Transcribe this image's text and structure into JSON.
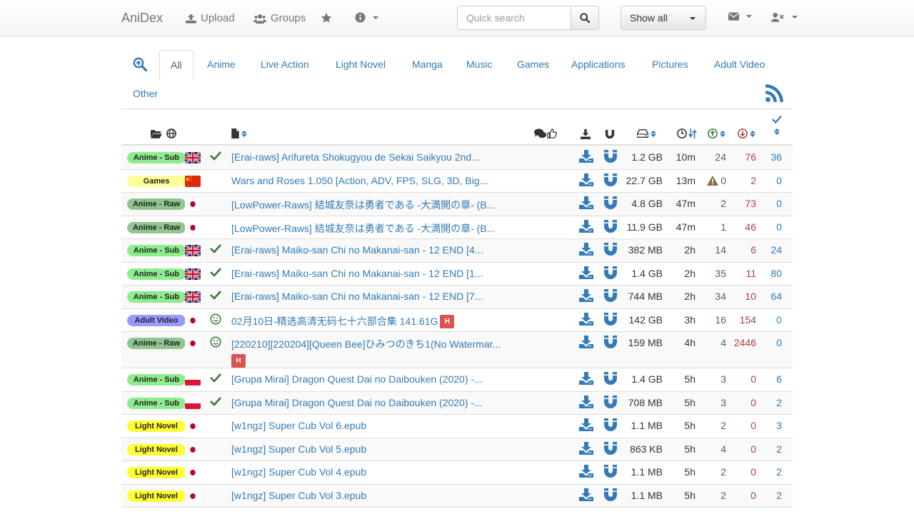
{
  "nav": {
    "brand": "AniDex",
    "upload": "Upload",
    "groups": "Groups",
    "search_placeholder": "Quick search",
    "filter_value": "Show all"
  },
  "tabs": [
    "All",
    "Anime",
    "Live Action",
    "Light Novel",
    "Manga",
    "Music",
    "Games",
    "Applications",
    "Pictures",
    "Adult Video",
    "Other"
  ],
  "active_tab": "All",
  "colors": {
    "anime_sub": "#8ded8d",
    "games": "#ffff99",
    "anime_raw": "#8fc58f",
    "adult_video": "#9999ff",
    "light_novel": "#ffff33",
    "link": "#337ab7",
    "seed_green": "#3c763d",
    "leech_red": "#a94442"
  },
  "rows": [
    {
      "category": "Anime - Sub",
      "cat_color": "#8ded8d",
      "flag": "gb",
      "status": "check",
      "title": "[Erai-raws] Arifureta Shokugyou de Sekai Saikyou 2nd...",
      "h": false,
      "size": "1.2 GB",
      "age": "10m",
      "seeders": "24",
      "leechers": "76",
      "completed": "36",
      "warn": false
    },
    {
      "category": "Games",
      "cat_color": "#ffff99",
      "flag": "cn",
      "status": "",
      "title": "Wars and Roses 1.050 [Action, ADV, FPS, SLG, 3D, Big...",
      "h": false,
      "size": "22.7 GB",
      "age": "13m",
      "seeders": "0",
      "leechers": "2",
      "completed": "0",
      "warn": true
    },
    {
      "category": "Anime - Raw",
      "cat_color": "#8fc58f",
      "flag": "jp",
      "status": "",
      "title": "[LowPower-Raws] 結城友奈は勇者である -大満開の章- (B...",
      "h": false,
      "size": "4.8 GB",
      "age": "47m",
      "seeders": "2",
      "leechers": "73",
      "completed": "0",
      "warn": false
    },
    {
      "category": "Anime - Raw",
      "cat_color": "#8fc58f",
      "flag": "jp",
      "status": "",
      "title": "[LowPower-Raws] 結城友奈は勇者である -大満開の章- (B...",
      "h": false,
      "size": "11.9 GB",
      "age": "47m",
      "seeders": "1",
      "leechers": "46",
      "completed": "0",
      "warn": false
    },
    {
      "category": "Anime - Sub",
      "cat_color": "#8ded8d",
      "flag": "gb",
      "status": "check",
      "title": "[Erai-raws] Maiko-san Chi no Makanai-san - 12 END [4...",
      "h": false,
      "size": "382 MB",
      "age": "2h",
      "seeders": "14",
      "leechers": "6",
      "completed": "24",
      "warn": false
    },
    {
      "category": "Anime - Sub",
      "cat_color": "#8ded8d",
      "flag": "gb",
      "status": "check",
      "title": "[Erai-raws] Maiko-san Chi no Makanai-san - 12 END [1...",
      "h": false,
      "size": "1.4 GB",
      "age": "2h",
      "seeders": "35",
      "leechers": "11",
      "completed": "80",
      "warn": false
    },
    {
      "category": "Anime - Sub",
      "cat_color": "#8ded8d",
      "flag": "gb",
      "status": "check",
      "title": "[Erai-raws] Maiko-san Chi no Makanai-san - 12 END [7...",
      "h": false,
      "size": "744 MB",
      "age": "2h",
      "seeders": "34",
      "leechers": "10",
      "completed": "64",
      "warn": false
    },
    {
      "category": "Adult Video",
      "cat_color": "#9999ff",
      "flag": "jp",
      "status": "smile",
      "title": "02月10日-精选高清无码七十六部合集 141.61G",
      "h": true,
      "h_block": false,
      "size": "142 GB",
      "age": "3h",
      "seeders": "16",
      "leechers": "154",
      "completed": "0",
      "warn": false
    },
    {
      "category": "Anime - Raw",
      "cat_color": "#8fc58f",
      "flag": "jp",
      "status": "smile",
      "title": "[220210][220204][Queen Bee]ひみつのきち1(No Watermar...",
      "h": true,
      "h_block": true,
      "size": "159 MB",
      "age": "4h",
      "seeders": "4",
      "leechers": "2446",
      "completed": "0",
      "warn": false
    },
    {
      "category": "Anime - Sub",
      "cat_color": "#8ded8d",
      "flag": "pl",
      "status": "check",
      "title": "[Grupa Mirai] Dragon Quest Dai no Daibouken (2020) -...",
      "h": false,
      "size": "1.4 GB",
      "age": "5h",
      "seeders": "3",
      "leechers": "0",
      "completed": "6",
      "warn": false
    },
    {
      "category": "Anime - Sub",
      "cat_color": "#8ded8d",
      "flag": "pl",
      "status": "check",
      "title": "[Grupa Mirai] Dragon Quest Dai no Daibouken (2020) -...",
      "h": false,
      "size": "708 MB",
      "age": "5h",
      "seeders": "3",
      "leechers": "0",
      "completed": "2",
      "warn": false
    },
    {
      "category": "Light Novel",
      "cat_color": "#ffff33",
      "flag": "jp",
      "status": "",
      "title": "[w1ngz] Super Cub Vol 6.epub",
      "h": false,
      "size": "1.1 MB",
      "age": "5h",
      "seeders": "2",
      "leechers": "0",
      "completed": "3",
      "warn": false
    },
    {
      "category": "Light Novel",
      "cat_color": "#ffff33",
      "flag": "jp",
      "status": "",
      "title": "[w1ngz] Super Cub Vol 5.epub",
      "h": false,
      "size": "863 KB",
      "age": "5h",
      "seeders": "4",
      "leechers": "0",
      "completed": "2",
      "warn": false
    },
    {
      "category": "Light Novel",
      "cat_color": "#ffff33",
      "flag": "jp",
      "status": "",
      "title": "[w1ngz] Super Cub Vol 4.epub",
      "h": false,
      "size": "1.1 MB",
      "age": "5h",
      "seeders": "2",
      "leechers": "0",
      "completed": "2",
      "warn": false
    },
    {
      "category": "Light Novel",
      "cat_color": "#ffff33",
      "flag": "jp",
      "status": "",
      "title": "[w1ngz] Super Cub Vol 3.epub",
      "h": false,
      "size": "1.1 MB",
      "age": "5h",
      "seeders": "2",
      "leechers": "0",
      "completed": "2",
      "warn": false
    }
  ],
  "h_label": "H"
}
